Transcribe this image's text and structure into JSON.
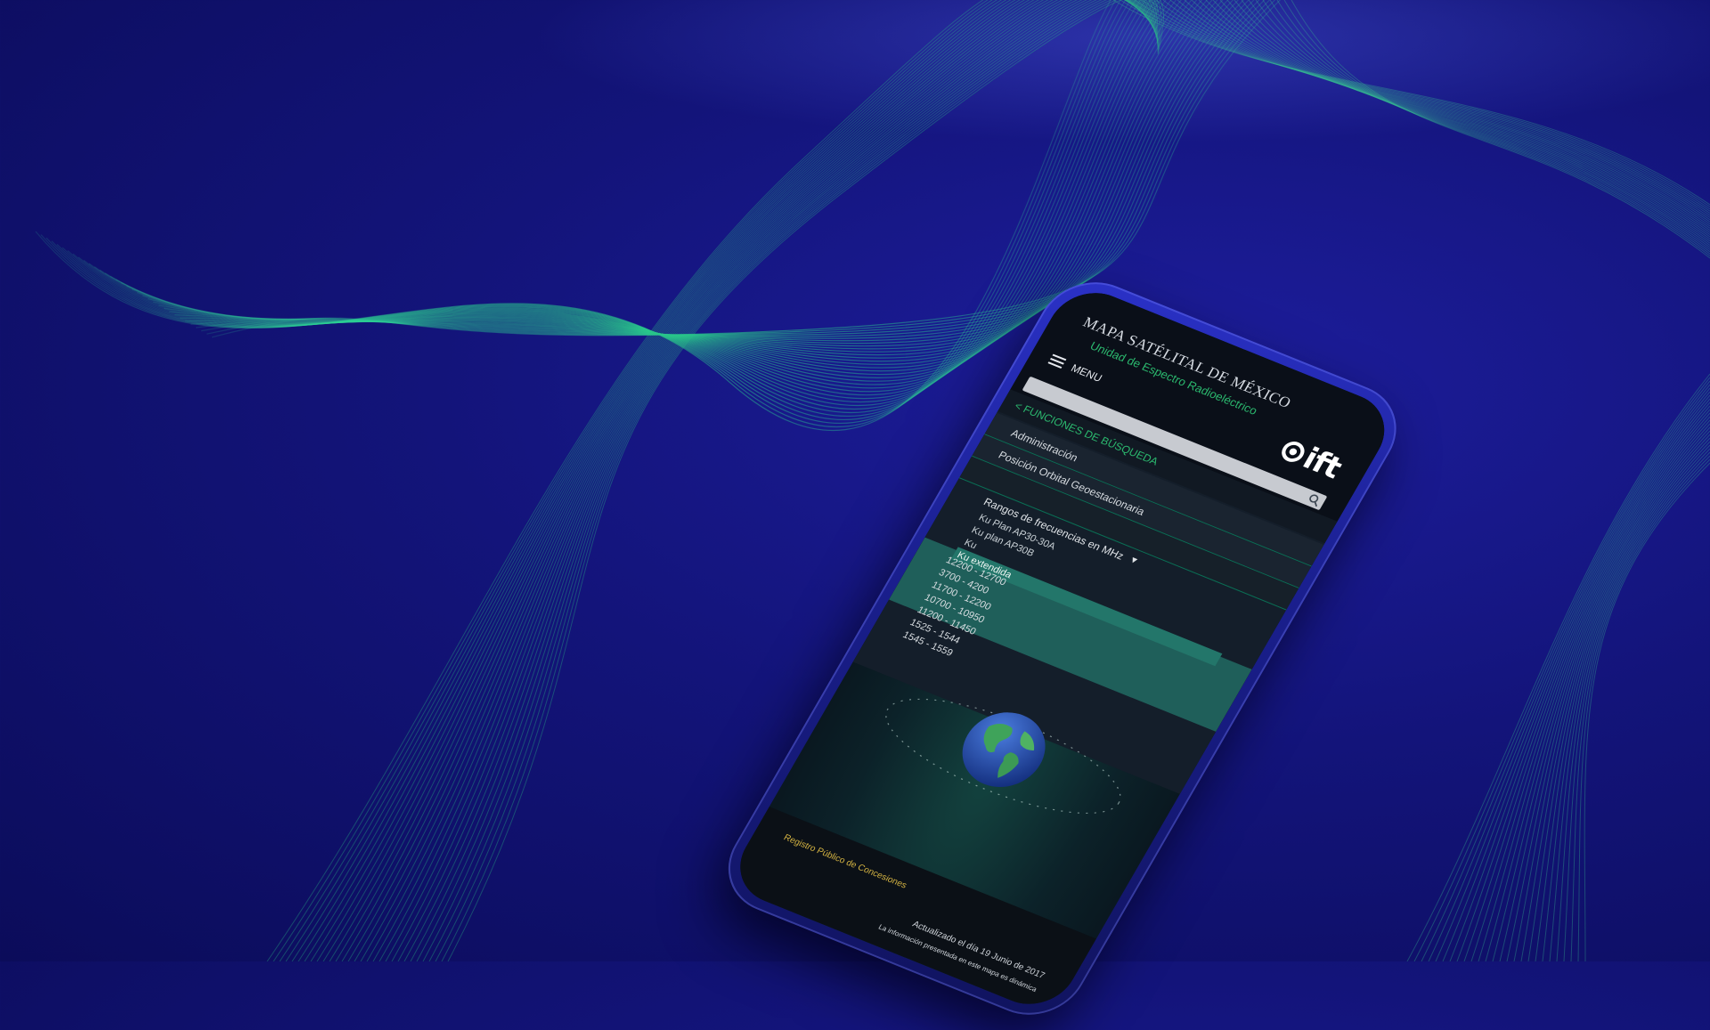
{
  "app": {
    "title": "MAPA SATÉLITAL DE MÉXICO",
    "subtitle": "Unidad de Espectro Radioeléctrico",
    "menu_label": "MENU",
    "logo_text": "ift",
    "accent_color": "#2bb86e",
    "brand_color": "#1a1f8f"
  },
  "search": {
    "placeholder": "",
    "icon": "search-icon"
  },
  "nav": {
    "back_label": "< FUNCIONES DE BÚSQUEDA",
    "items": [
      "Administración",
      "Posición Orbital Geoestacionaria"
    ]
  },
  "filter": {
    "label": "Rangos de frecuencias en MHz",
    "options": [
      "Ku Plan AP30-30A",
      "Ku plan AP30B",
      "Ku",
      "Ku extendida"
    ],
    "selected_index": 3
  },
  "ranges": [
    "12200 - 12700",
    "3700 - 4200",
    "11700 - 12200",
    "10700 - 10950",
    "11200 - 11450",
    "1525 - 1544",
    "1545 - 1559"
  ],
  "footer": {
    "registry_link": "Registro Público de Concesiones",
    "updated": "Actualizado el día 19 Junio de 2017",
    "note": "La información presentada en este mapa es dinámica"
  }
}
